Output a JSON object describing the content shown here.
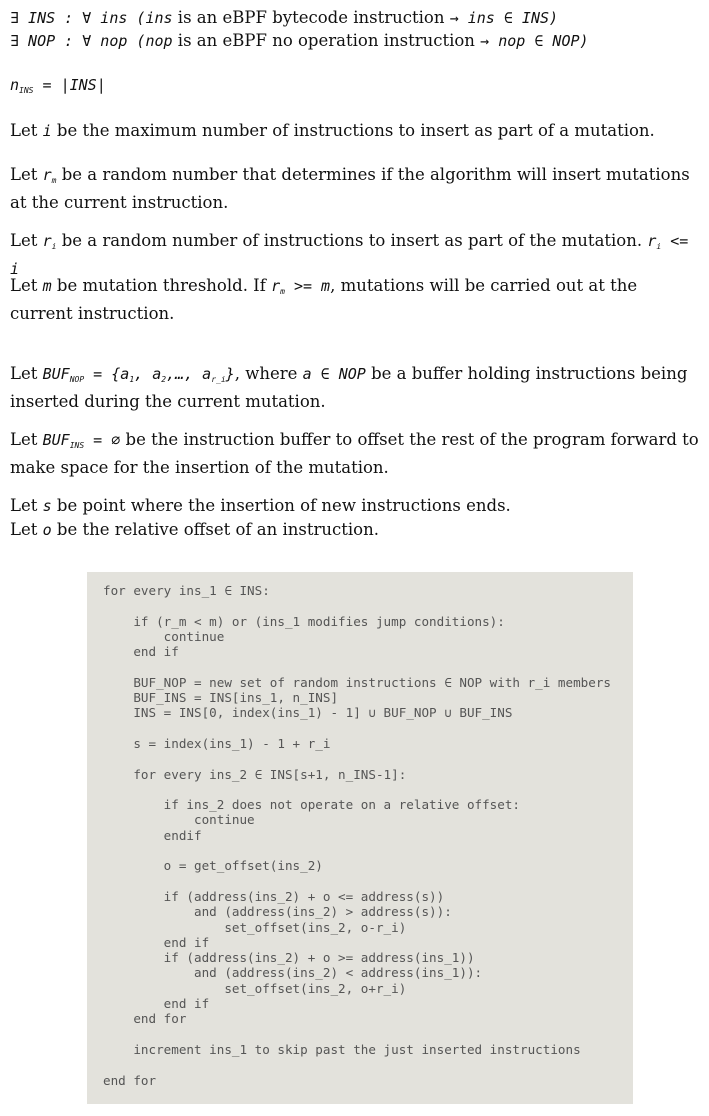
{
  "defs": {
    "ins_def": {
      "pre": "∃ INS : ∀ ins (",
      "ins": "ins",
      "mid": " is an eBPF bytecode instruction ",
      "post": "→ ins ∈ INS)"
    },
    "nop_def": {
      "pre": "∃ NOP : ∀ nop (",
      "ins": "nop",
      "mid": " is an eBPF no operation instruction ",
      "post": "→ nop ∈ NOP)"
    },
    "n_ins": {
      "n": "n",
      "sub": "INS",
      "post": " = |INS|"
    }
  },
  "paragraphs": {
    "p_i": {
      "a": "Let ",
      "v": "i",
      "b": " be the maximum number of instructions to insert as part of a mutation."
    },
    "p_rm": {
      "a": "Let ",
      "v": "r",
      "sub": "m",
      "b": " be a random number that determines if the algorithm will insert mutations at the current instruction."
    },
    "p_ri": {
      "a": "Let ",
      "v": "r",
      "sub": "i",
      "b": " be a random number of instructions to insert as part of the mutation. ",
      "c": "r",
      "csub": "i",
      "d": " <= i"
    },
    "p_m": {
      "a": "Let ",
      "v": "m",
      "b": " be mutation threshold. If ",
      "c": "r",
      "csub": "m",
      "d": " >= m",
      "e": ", mutations will be carried out at the current instruction."
    },
    "p_bufnop": {
      "a": "Let ",
      "v": "BUF",
      "sub": "NOP",
      "b": " = {a",
      "s1": "1",
      "b2": ", a",
      "s2": "2",
      "b3": ",…, a",
      "s3": "r_i",
      "b4": "}",
      "c": ", where ",
      "d": "a ∈ NOP",
      "e": " be a buffer holding instructions being inserted during the current mutation."
    },
    "p_bufins": {
      "a": "Let ",
      "v": "BUF",
      "sub": "INS",
      "b": " = ∅",
      "c": " be the instruction buffer to offset the rest of the program forward to make space for the insertion of the mutation."
    },
    "p_s": {
      "a": "Let ",
      "v": "s",
      "b": " be point where the insertion of new instructions ends."
    },
    "p_o": {
      "a": "Let ",
      "v": "o",
      "b": " be the relative offset of an instruction."
    }
  },
  "code_lines": [
    "for every ins_1 ∈ INS:",
    "",
    "    if (r_m < m) or (ins_1 modifies jump conditions):",
    "        continue",
    "    end if",
    "",
    "    BUF_NOP = new set of random instructions ∈ NOP with r_i members",
    "    BUF_INS = INS[ins_1, n_INS]",
    "    INS = INS[0, index(ins_1) - 1] ∪ BUF_NOP ∪ BUF_INS",
    "",
    "    s = index(ins_1) - 1 + r_i",
    "",
    "    for every ins_2 ∈ INS[s+1, n_INS-1]:",
    "",
    "        if ins_2 does not operate on a relative offset:",
    "            continue",
    "        endif",
    "",
    "        o = get_offset(ins_2)",
    "",
    "        if (address(ins_2) + o <= address(s))",
    "            and (address(ins_2) > address(s)):",
    "                set_offset(ins_2, o-r_i)",
    "        end if",
    "        if (address(ins_2) + o >= address(ins_1))",
    "            and (address(ins_2) < address(ins_1)):",
    "                set_offset(ins_2, o+r_i)",
    "        end if",
    "    end for",
    "",
    "    increment ins_1 to skip past the just inserted instructions",
    "",
    "end for"
  ]
}
